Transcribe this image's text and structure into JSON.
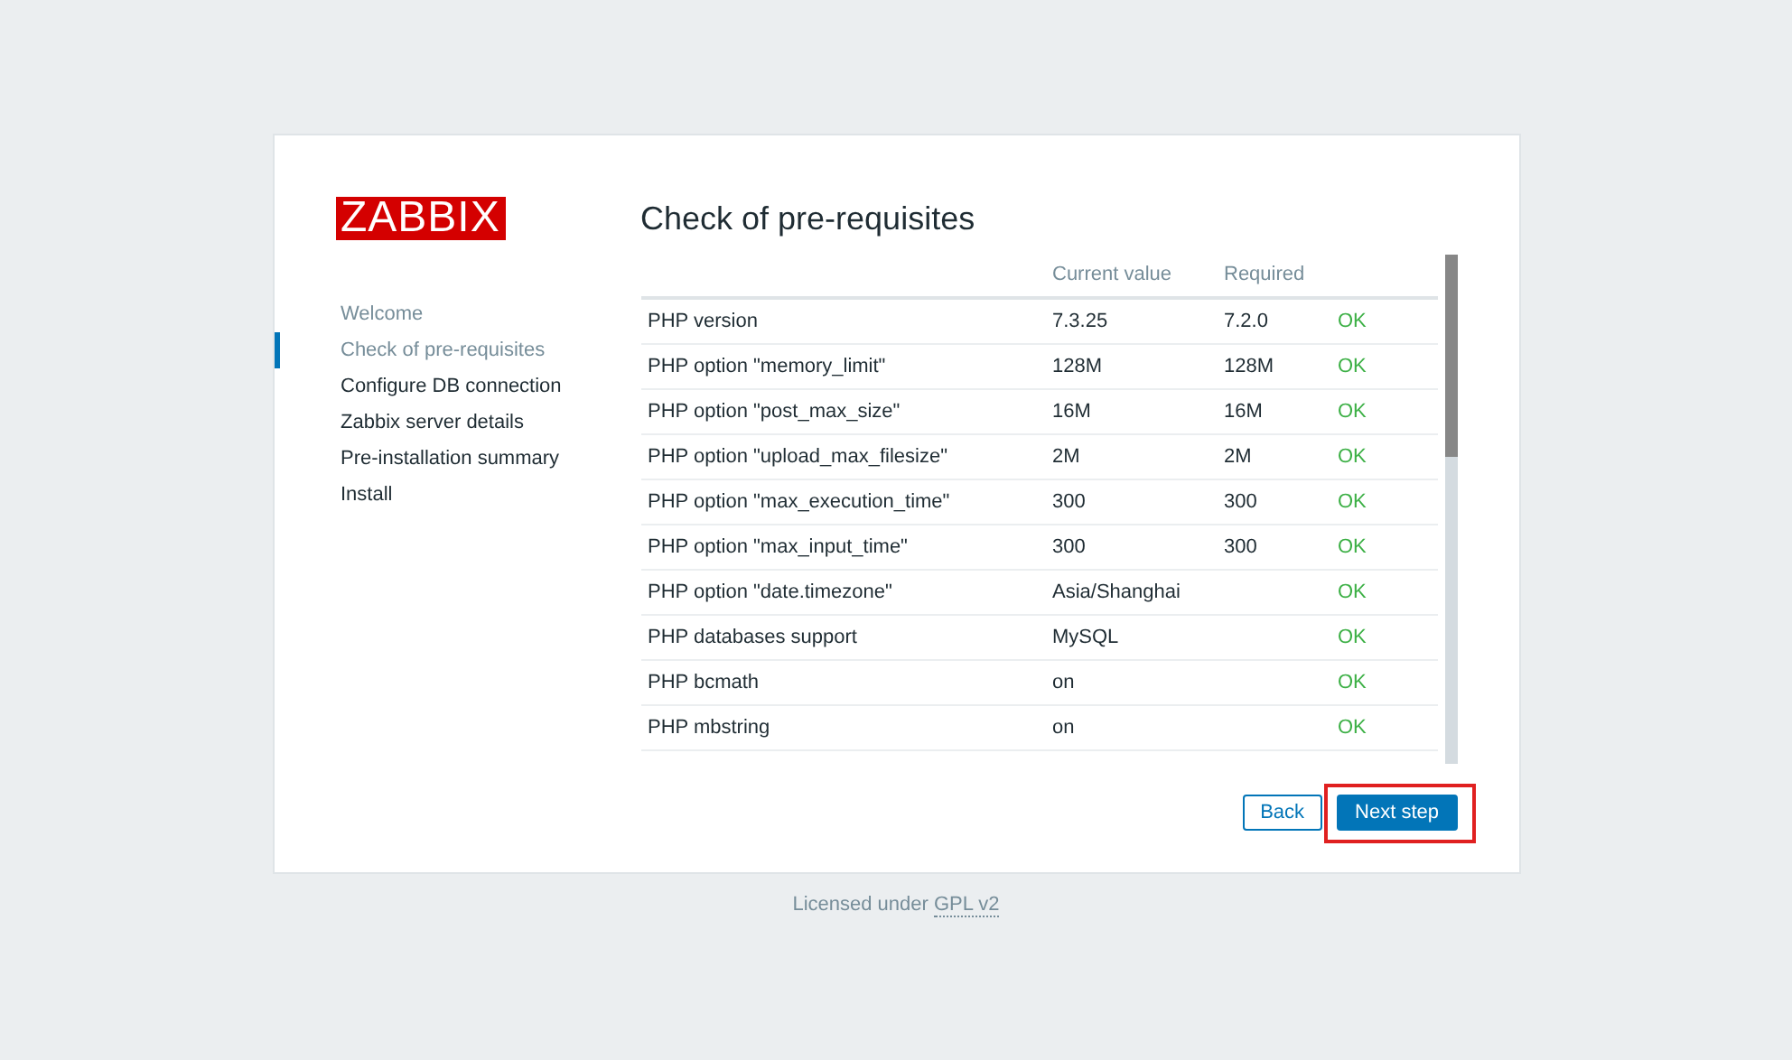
{
  "logo": "ZABBIX",
  "steps": [
    {
      "label": "Welcome",
      "visited": true,
      "selected": false
    },
    {
      "label": "Check of pre-requisites",
      "visited": true,
      "selected": true
    },
    {
      "label": "Configure DB connection",
      "visited": false,
      "selected": false
    },
    {
      "label": "Zabbix server details",
      "visited": false,
      "selected": false
    },
    {
      "label": "Pre-installation summary",
      "visited": false,
      "selected": false
    },
    {
      "label": "Install",
      "visited": false,
      "selected": false
    }
  ],
  "title": "Check of pre-requisites",
  "table": {
    "columns": [
      "Current value",
      "Required"
    ],
    "rows": [
      {
        "name": "PHP version",
        "current": "7.3.25",
        "required": "7.2.0",
        "status": "OK",
        "ok": true
      },
      {
        "name": "PHP option \"memory_limit\"",
        "current": "128M",
        "required": "128M",
        "status": "OK",
        "ok": true
      },
      {
        "name": "PHP option \"post_max_size\"",
        "current": "16M",
        "required": "16M",
        "status": "OK",
        "ok": true
      },
      {
        "name": "PHP option \"upload_max_filesize\"",
        "current": "2M",
        "required": "2M",
        "status": "OK",
        "ok": true
      },
      {
        "name": "PHP option \"max_execution_time\"",
        "current": "300",
        "required": "300",
        "status": "OK",
        "ok": true
      },
      {
        "name": "PHP option \"max_input_time\"",
        "current": "300",
        "required": "300",
        "status": "OK",
        "ok": true
      },
      {
        "name": "PHP option \"date.timezone\"",
        "current": "Asia/Shanghai",
        "status": "OK",
        "ok": true
      },
      {
        "name": "PHP databases support",
        "current": "MySQL",
        "status": "OK",
        "ok": true
      },
      {
        "name": "PHP bcmath",
        "current": "on",
        "status": "OK",
        "ok": true
      },
      {
        "name": "PHP mbstring",
        "current": "on",
        "status": "OK",
        "ok": true
      }
    ]
  },
  "buttons": [
    {
      "label": "Back",
      "kind": "secondary",
      "highlighted": false
    },
    {
      "label": "Next step",
      "kind": "primary",
      "highlighted": true
    }
  ],
  "footer": {
    "text": "Licensed under",
    "link": "GPL v2"
  }
}
